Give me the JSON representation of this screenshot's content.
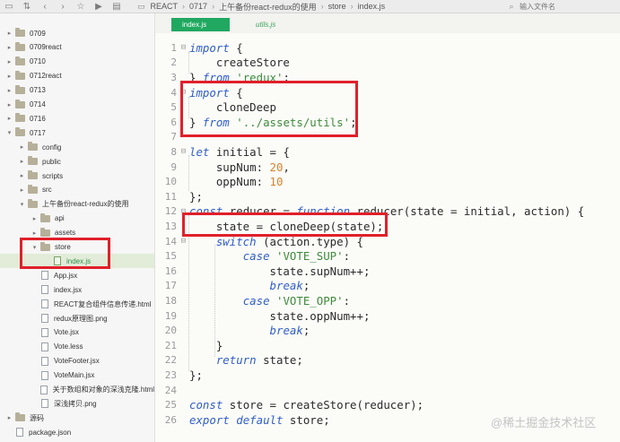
{
  "breadcrumbs": [
    "REACT",
    "0717",
    "上午备份react-redux的使用",
    "store",
    "index.js"
  ],
  "search": {
    "placeholder": "输入文件名"
  },
  "tree": [
    {
      "label": "0709",
      "indent": 0,
      "type": "folder",
      "arrow": "▸"
    },
    {
      "label": "0709react",
      "indent": 0,
      "type": "folder",
      "arrow": "▸"
    },
    {
      "label": "0710",
      "indent": 0,
      "type": "folder",
      "arrow": "▸"
    },
    {
      "label": "0712react",
      "indent": 0,
      "type": "folder",
      "arrow": "▸"
    },
    {
      "label": "0713",
      "indent": 0,
      "type": "folder",
      "arrow": "▸"
    },
    {
      "label": "0714",
      "indent": 0,
      "type": "folder",
      "arrow": "▸"
    },
    {
      "label": "0716",
      "indent": 0,
      "type": "folder",
      "arrow": "▸"
    },
    {
      "label": "0717",
      "indent": 0,
      "type": "folder",
      "arrow": "▾"
    },
    {
      "label": "config",
      "indent": 1,
      "type": "folder",
      "arrow": "▸"
    },
    {
      "label": "public",
      "indent": 1,
      "type": "folder",
      "arrow": "▸"
    },
    {
      "label": "scripts",
      "indent": 1,
      "type": "folder",
      "arrow": "▸"
    },
    {
      "label": "src",
      "indent": 1,
      "type": "folder",
      "arrow": "▸"
    },
    {
      "label": "上午备份react-redux的使用",
      "indent": 1,
      "type": "folder",
      "arrow": "▾"
    },
    {
      "label": "api",
      "indent": 2,
      "type": "folder",
      "arrow": "▸"
    },
    {
      "label": "assets",
      "indent": 2,
      "type": "folder",
      "arrow": "▸"
    },
    {
      "label": "store",
      "indent": 2,
      "type": "folder",
      "arrow": "▾"
    },
    {
      "label": "index.js",
      "indent": 3,
      "type": "js",
      "arrow": "",
      "selected": true
    },
    {
      "label": "App.jsx",
      "indent": 2,
      "type": "file",
      "arrow": ""
    },
    {
      "label": "index.jsx",
      "indent": 2,
      "type": "file",
      "arrow": ""
    },
    {
      "label": "REACT复合组件信息传递.html",
      "indent": 2,
      "type": "file",
      "arrow": ""
    },
    {
      "label": "redux原理图.png",
      "indent": 2,
      "type": "file",
      "arrow": ""
    },
    {
      "label": "Vote.jsx",
      "indent": 2,
      "type": "file",
      "arrow": ""
    },
    {
      "label": "Vote.less",
      "indent": 2,
      "type": "file",
      "arrow": ""
    },
    {
      "label": "VoteFooter.jsx",
      "indent": 2,
      "type": "file",
      "arrow": ""
    },
    {
      "label": "VoteMain.jsx",
      "indent": 2,
      "type": "file",
      "arrow": ""
    },
    {
      "label": "关于数组和对象的深浅克隆.html",
      "indent": 2,
      "type": "file",
      "arrow": ""
    },
    {
      "label": "深浅拷贝.png",
      "indent": 2,
      "type": "file",
      "arrow": ""
    },
    {
      "label": "源码",
      "indent": 0,
      "type": "folder",
      "arrow": "▸"
    },
    {
      "label": "package.json",
      "indent": 0,
      "type": "file",
      "arrow": ""
    }
  ],
  "tabs": [
    {
      "label": "index.js",
      "active": true
    },
    {
      "label": "utils.js",
      "active": false
    }
  ],
  "colors": {
    "keyword": "#2f5ec9",
    "string": "#3d8b3a",
    "number": "#d9822b",
    "plain": "#2b2b2b",
    "accent": "#20a860",
    "highlight": "#e0202a"
  },
  "code": [
    {
      "n": "1",
      "fold": "⊟",
      "tokens": [
        [
          "kw",
          "import"
        ],
        [
          "p",
          " {"
        ]
      ]
    },
    {
      "n": "2",
      "fold": "",
      "tokens": [
        [
          "p",
          "    createStore"
        ]
      ]
    },
    {
      "n": "3",
      "fold": "",
      "tokens": [
        [
          "p",
          "} "
        ],
        [
          "kw",
          "from"
        ],
        [
          "p",
          " "
        ],
        [
          "str",
          "'redux'"
        ],
        [
          "p",
          ";"
        ]
      ]
    },
    {
      "n": "4",
      "fold": "⊟",
      "tokens": [
        [
          "kw",
          "import"
        ],
        [
          "p",
          " {"
        ]
      ]
    },
    {
      "n": "5",
      "fold": "",
      "tokens": [
        [
          "p",
          "    cloneDeep"
        ]
      ]
    },
    {
      "n": "6",
      "fold": "",
      "tokens": [
        [
          "p",
          "} "
        ],
        [
          "kw",
          "from"
        ],
        [
          "p",
          " "
        ],
        [
          "str",
          "'../assets/utils'"
        ],
        [
          "p",
          ";"
        ]
      ]
    },
    {
      "n": "7",
      "fold": "",
      "tokens": []
    },
    {
      "n": "8",
      "fold": "⊟",
      "tokens": [
        [
          "kw",
          "let"
        ],
        [
          "p",
          " initial = {"
        ]
      ]
    },
    {
      "n": "9",
      "fold": "",
      "tokens": [
        [
          "p",
          "    supNum: "
        ],
        [
          "num",
          "20"
        ],
        [
          "p",
          ","
        ]
      ]
    },
    {
      "n": "10",
      "fold": "",
      "tokens": [
        [
          "p",
          "    oppNum: "
        ],
        [
          "num",
          "10"
        ]
      ]
    },
    {
      "n": "11",
      "fold": "",
      "tokens": [
        [
          "p",
          "};"
        ]
      ]
    },
    {
      "n": "12",
      "fold": "⊟",
      "tokens": [
        [
          "kw",
          "const"
        ],
        [
          "p",
          " reducer = "
        ],
        [
          "kw",
          "function"
        ],
        [
          "p",
          " reducer(state = initial, action) {"
        ]
      ]
    },
    {
      "n": "13",
      "fold": "",
      "tokens": [
        [
          "p",
          "    state = cloneDeep(state);"
        ]
      ]
    },
    {
      "n": "14",
      "fold": "⊟",
      "tokens": [
        [
          "p",
          "    "
        ],
        [
          "kw",
          "switch"
        ],
        [
          "p",
          " (action.type) {"
        ]
      ]
    },
    {
      "n": "15",
      "fold": "",
      "tokens": [
        [
          "p",
          "        "
        ],
        [
          "kw",
          "case"
        ],
        [
          "p",
          " "
        ],
        [
          "str",
          "'VOTE_SUP'"
        ],
        [
          "p",
          ":"
        ]
      ]
    },
    {
      "n": "16",
      "fold": "",
      "tokens": [
        [
          "p",
          "            state.supNum++;"
        ]
      ]
    },
    {
      "n": "17",
      "fold": "",
      "tokens": [
        [
          "p",
          "            "
        ],
        [
          "kw",
          "break"
        ],
        [
          "p",
          ";"
        ]
      ]
    },
    {
      "n": "18",
      "fold": "",
      "tokens": [
        [
          "p",
          "        "
        ],
        [
          "kw",
          "case"
        ],
        [
          "p",
          " "
        ],
        [
          "str",
          "'VOTE_OPP'"
        ],
        [
          "p",
          ":"
        ]
      ]
    },
    {
      "n": "19",
      "fold": "",
      "tokens": [
        [
          "p",
          "            state.oppNum++;"
        ]
      ]
    },
    {
      "n": "20",
      "fold": "",
      "tokens": [
        [
          "p",
          "            "
        ],
        [
          "kw",
          "break"
        ],
        [
          "p",
          ";"
        ]
      ]
    },
    {
      "n": "21",
      "fold": "",
      "tokens": [
        [
          "p",
          "    }"
        ]
      ]
    },
    {
      "n": "22",
      "fold": "",
      "tokens": [
        [
          "p",
          "    "
        ],
        [
          "kw",
          "return"
        ],
        [
          "p",
          " state;"
        ]
      ]
    },
    {
      "n": "23",
      "fold": "",
      "tokens": [
        [
          "p",
          "};"
        ]
      ]
    },
    {
      "n": "24",
      "fold": "",
      "tokens": []
    },
    {
      "n": "25",
      "fold": "",
      "tokens": [
        [
          "kw",
          "const"
        ],
        [
          "p",
          " store = createStore(reducer);"
        ]
      ]
    },
    {
      "n": "26",
      "fold": "",
      "tokens": [
        [
          "kw",
          "export"
        ],
        [
          "p",
          " "
        ],
        [
          "kw",
          "default"
        ],
        [
          "p",
          " store;"
        ]
      ]
    }
  ],
  "watermark": "@稀土掘金技术社区"
}
